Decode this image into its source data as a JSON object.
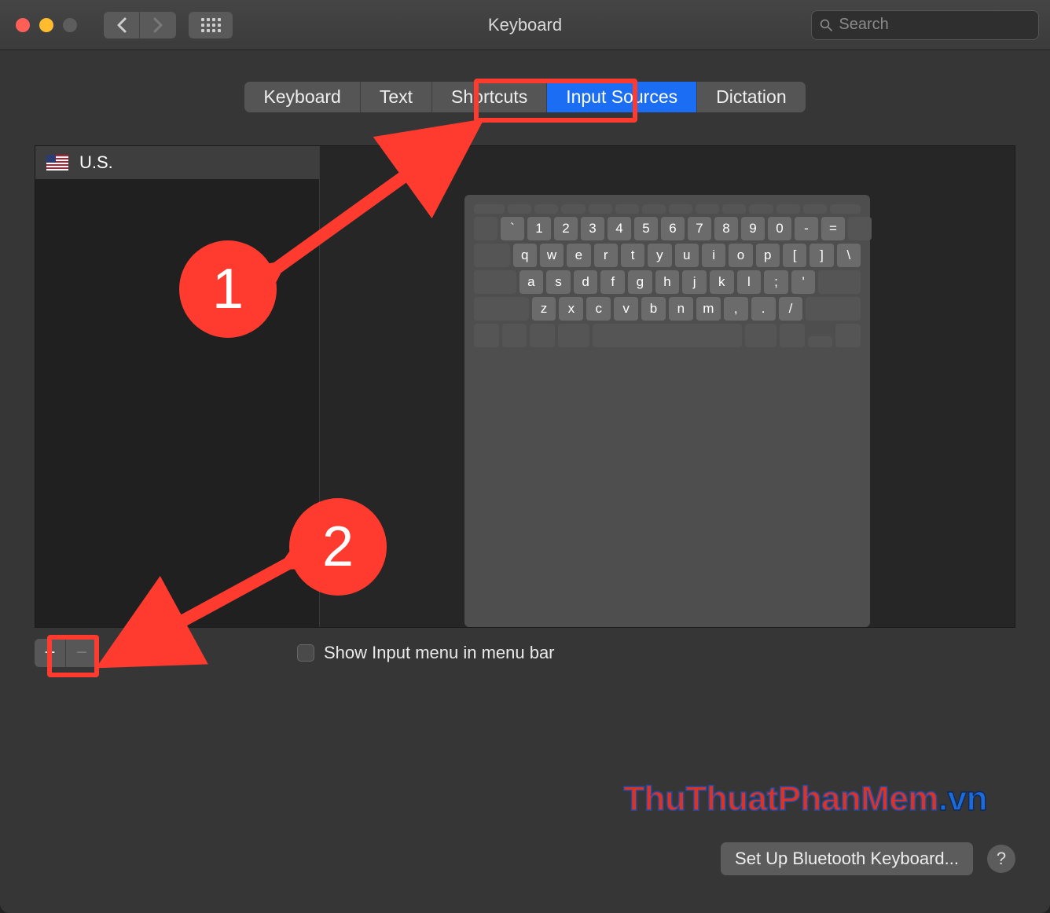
{
  "window": {
    "title": "Keyboard"
  },
  "search": {
    "placeholder": "Search"
  },
  "tabs": {
    "items": [
      "Keyboard",
      "Text",
      "Shortcuts",
      "Input Sources",
      "Dictation"
    ],
    "active_index": 3
  },
  "sources": {
    "items": [
      {
        "flag": "us",
        "label": "U.S."
      }
    ]
  },
  "keyboard_layout": {
    "row1": [
      "`",
      "1",
      "2",
      "3",
      "4",
      "5",
      "6",
      "7",
      "8",
      "9",
      "0",
      "-",
      "="
    ],
    "row2": [
      "q",
      "w",
      "e",
      "r",
      "t",
      "y",
      "u",
      "i",
      "o",
      "p",
      "[",
      "]",
      "\\"
    ],
    "row3": [
      "a",
      "s",
      "d",
      "f",
      "g",
      "h",
      "j",
      "k",
      "l",
      ";",
      "'"
    ],
    "row4": [
      "z",
      "x",
      "c",
      "v",
      "b",
      "n",
      "m",
      ",",
      ".",
      "/"
    ]
  },
  "add_remove": {
    "add_glyph": "+",
    "remove_glyph": "−"
  },
  "checkbox": {
    "label": "Show Input menu in menu bar",
    "checked": false
  },
  "footer": {
    "bluetooth_btn": "Set Up Bluetooth Keyboard...",
    "help_glyph": "?"
  },
  "annotations": {
    "badge1": "1",
    "badge2": "2"
  },
  "watermark": {
    "part1": "ThuThuatPhanMem",
    "part2": ".vn"
  }
}
